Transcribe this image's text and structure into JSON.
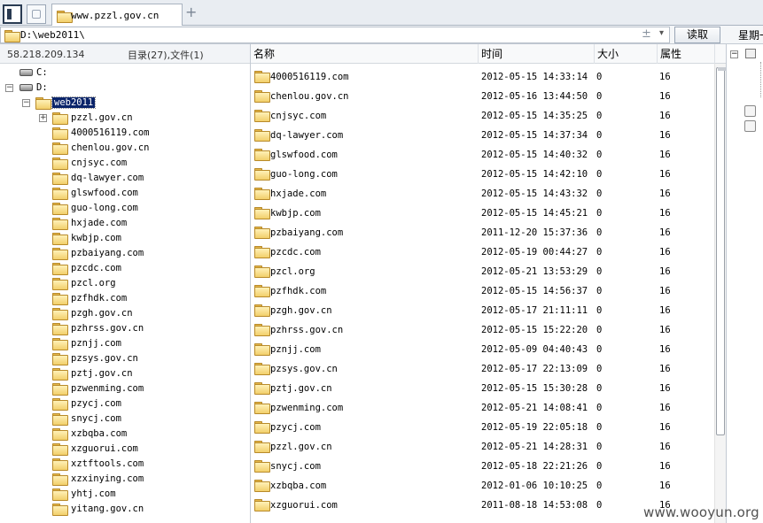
{
  "tab": {
    "title": "www.pzzl.gov.cn",
    "add_label": "+"
  },
  "address": {
    "path": "D:\\web2011\\",
    "plusminus": "±",
    "dropdown": "▾",
    "read_button": "读取",
    "weekday": "星期一"
  },
  "left_header": {
    "ip": "58.218.209.134",
    "summary": "目录(27),文件(1)"
  },
  "tree": {
    "drives": [
      {
        "label": "C:"
      },
      {
        "label": "D:"
      }
    ],
    "selected": "web2011",
    "children": [
      "pzzl.gov.cn",
      "4000516119.com",
      "chenlou.gov.cn",
      "cnjsyc.com",
      "dq-lawyer.com",
      "glswfood.com",
      "guo-long.com",
      "hxjade.com",
      "kwbjp.com",
      "pzbaiyang.com",
      "pzcdc.com",
      "pzcl.org",
      "pzfhdk.com",
      "pzgh.gov.cn",
      "pzhrss.gov.cn",
      "pznjj.com",
      "pzsys.gov.cn",
      "pztj.gov.cn",
      "pzwenming.com",
      "pzycj.com",
      "snycj.com",
      "xzbqba.com",
      "xzguorui.com",
      "xztftools.com",
      "xzxinying.com",
      "yhtj.com",
      "yitang.gov.cn"
    ]
  },
  "columns": {
    "name": "名称",
    "time": "时间",
    "size": "大小",
    "attr": "属性"
  },
  "files": [
    {
      "name": "4000516119.com",
      "time": "2012-05-15 14:33:14",
      "size": "0",
      "attr": "16"
    },
    {
      "name": "chenlou.gov.cn",
      "time": "2012-05-16 13:44:50",
      "size": "0",
      "attr": "16"
    },
    {
      "name": "cnjsyc.com",
      "time": "2012-05-15 14:35:25",
      "size": "0",
      "attr": "16"
    },
    {
      "name": "dq-lawyer.com",
      "time": "2012-05-15 14:37:34",
      "size": "0",
      "attr": "16"
    },
    {
      "name": "glswfood.com",
      "time": "2012-05-15 14:40:32",
      "size": "0",
      "attr": "16"
    },
    {
      "name": "guo-long.com",
      "time": "2012-05-15 14:42:10",
      "size": "0",
      "attr": "16"
    },
    {
      "name": "hxjade.com",
      "time": "2012-05-15 14:43:32",
      "size": "0",
      "attr": "16"
    },
    {
      "name": "kwbjp.com",
      "time": "2012-05-15 14:45:21",
      "size": "0",
      "attr": "16"
    },
    {
      "name": "pzbaiyang.com",
      "time": "2011-12-20 15:37:36",
      "size": "0",
      "attr": "16"
    },
    {
      "name": "pzcdc.com",
      "time": "2012-05-19 00:44:27",
      "size": "0",
      "attr": "16"
    },
    {
      "name": "pzcl.org",
      "time": "2012-05-21 13:53:29",
      "size": "0",
      "attr": "16"
    },
    {
      "name": "pzfhdk.com",
      "time": "2012-05-15 14:56:37",
      "size": "0",
      "attr": "16"
    },
    {
      "name": "pzgh.gov.cn",
      "time": "2012-05-17 21:11:11",
      "size": "0",
      "attr": "16"
    },
    {
      "name": "pzhrss.gov.cn",
      "time": "2012-05-15 15:22:20",
      "size": "0",
      "attr": "16"
    },
    {
      "name": "pznjj.com",
      "time": "2012-05-09 04:40:43",
      "size": "0",
      "attr": "16"
    },
    {
      "name": "pzsys.gov.cn",
      "time": "2012-05-17 22:13:09",
      "size": "0",
      "attr": "16"
    },
    {
      "name": "pztj.gov.cn",
      "time": "2012-05-15 15:30:28",
      "size": "0",
      "attr": "16"
    },
    {
      "name": "pzwenming.com",
      "time": "2012-05-21 14:08:41",
      "size": "0",
      "attr": "16"
    },
    {
      "name": "pzycj.com",
      "time": "2012-05-19 22:05:18",
      "size": "0",
      "attr": "16"
    },
    {
      "name": "pzzl.gov.cn",
      "time": "2012-05-21 14:28:31",
      "size": "0",
      "attr": "16"
    },
    {
      "name": "snycj.com",
      "time": "2012-05-18 22:21:26",
      "size": "0",
      "attr": "16"
    },
    {
      "name": "xzbqba.com",
      "time": "2012-01-06 10:10:25",
      "size": "0",
      "attr": "16"
    },
    {
      "name": "xzguorui.com",
      "time": "2011-08-18 14:53:08",
      "size": "0",
      "attr": "16"
    }
  ],
  "watermark": "www.wooyun.org"
}
